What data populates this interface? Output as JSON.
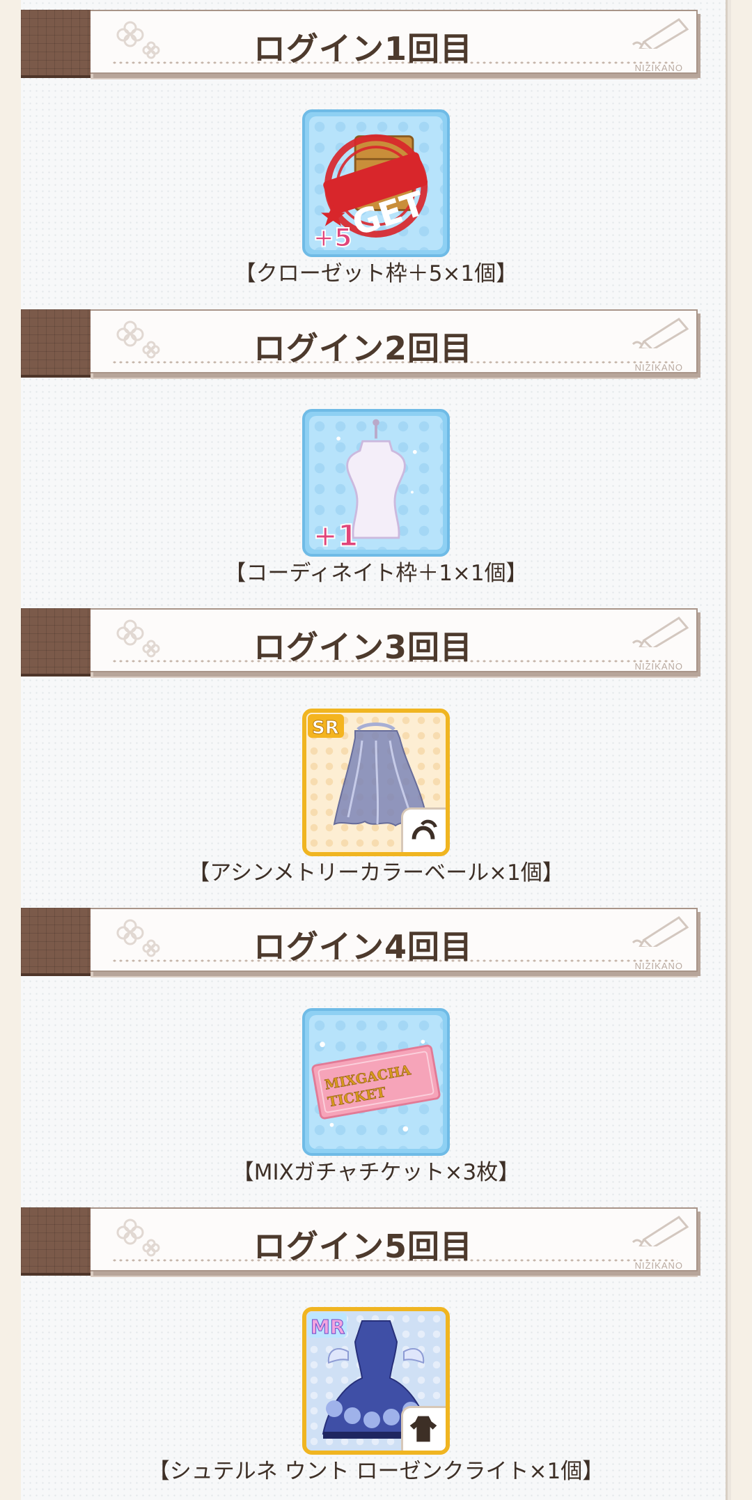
{
  "colors": {
    "brown": "#7b5a4a",
    "title_text": "#4d3a2d",
    "item_blue": "#8ed0f3",
    "item_gold": "#f0b521",
    "get_red": "#d8262b"
  },
  "brand": "NIZIKANO",
  "rewards": [
    {
      "title": "ログイン1回目",
      "caption": "【クローゼット枠＋5×1個】",
      "icon": "closet-get-icon",
      "plus_label": "+5",
      "stamp_label": "GET"
    },
    {
      "title": "ログイン2回目",
      "caption": "【コーディネイト枠＋1×1個】",
      "icon": "mannequin-icon",
      "plus_label": "+1"
    },
    {
      "title": "ログイン3回目",
      "caption": "【アシンメトリーカラーベール×1個】",
      "icon": "veil-icon",
      "rarity": "SR"
    },
    {
      "title": "ログイン4回目",
      "caption": "【MIXガチャチケット×3枚】",
      "icon": "ticket-icon",
      "ticket_text_1": "MIXGACHA",
      "ticket_text_2": "TICKET"
    },
    {
      "title": "ログイン5回目",
      "caption": "【シュテルネ ウント ローゼンクライト×1個】",
      "icon": "dress-icon",
      "rarity": "MR"
    }
  ]
}
